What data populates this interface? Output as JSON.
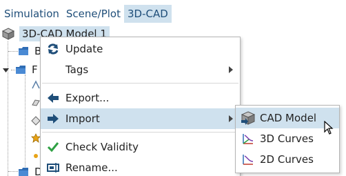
{
  "tabs": [
    {
      "label": "Simulation",
      "active": false
    },
    {
      "label": "Scene/Plot",
      "active": false
    },
    {
      "label": "3D-CAD",
      "active": true
    }
  ],
  "tree": {
    "root_label": "3D-CAD Model 1",
    "root_icon": "cad-model-icon",
    "children": [
      {
        "label": "B",
        "icon": "folder-icon",
        "expanded": false
      },
      {
        "label": "F",
        "icon": "folder-icon",
        "expanded": true
      },
      {
        "label": "D",
        "icon": "folder-icon",
        "expanded": false
      }
    ]
  },
  "context_menu": {
    "items": [
      {
        "label": "Update",
        "icon": "refresh-icon",
        "has_submenu": false
      },
      {
        "label": "Tags",
        "icon": "",
        "has_submenu": true
      },
      {
        "label": "Export...",
        "icon": "export-icon",
        "has_submenu": false
      },
      {
        "label": "Import",
        "icon": "import-icon",
        "has_submenu": true,
        "highlighted": true
      },
      {
        "label": "Check Validity",
        "icon": "checkmark-icon",
        "has_submenu": false
      },
      {
        "label": "Rename...",
        "icon": "rename-icon",
        "has_submenu": false
      }
    ]
  },
  "import_submenu": {
    "items": [
      {
        "label": "CAD Model",
        "icon": "cad-model-icon",
        "highlighted": true
      },
      {
        "label": "3D Curves",
        "icon": "3d-curves-icon"
      },
      {
        "label": "2D Curves",
        "icon": "2d-curves-icon"
      }
    ]
  },
  "colors": {
    "highlight": "#cfe1ee",
    "tab_text": "#1f4e79",
    "folder_blue": "#2f6db5",
    "check_green": "#2ea043"
  }
}
